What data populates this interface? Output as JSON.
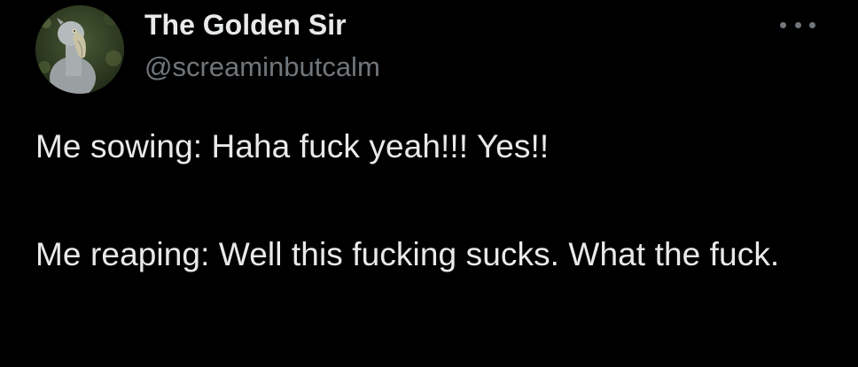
{
  "author": {
    "display_name": "The Golden Sir",
    "handle": "@screaminbutcalm",
    "avatar_icon": "shoebill-avatar-icon"
  },
  "menu": {
    "icon": "more-options-icon"
  },
  "tweet": {
    "line1": "Me sowing: Haha fuck yeah!!! Yes!!",
    "line2": "Me reaping: Well this fucking sucks. What the fuck."
  },
  "colors": {
    "background": "#000000",
    "primary_text": "#e7e9ea",
    "secondary_text": "#71767b"
  }
}
